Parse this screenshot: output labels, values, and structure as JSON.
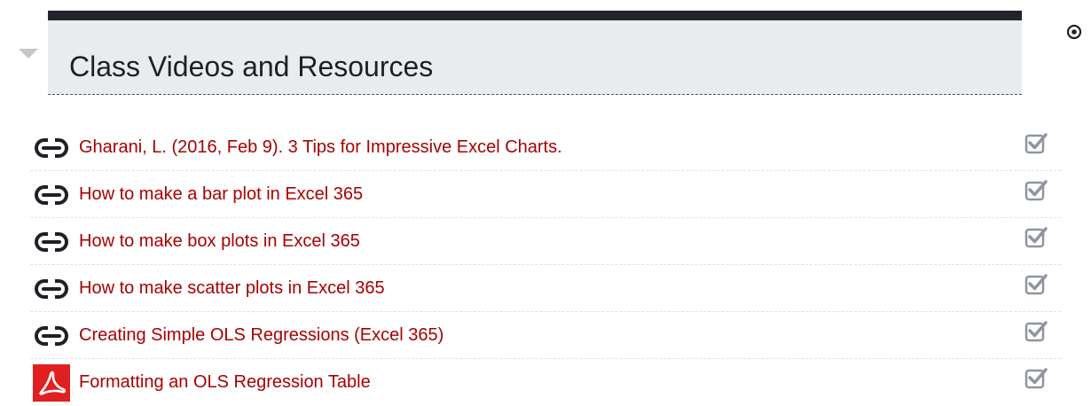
{
  "section": {
    "title": "Class Videos and Resources"
  },
  "activities": [
    {
      "type": "url",
      "icon": "link-icon",
      "label": "Gharani, L. (2016, Feb 9). 3 Tips for Impressive Excel Charts."
    },
    {
      "type": "url",
      "icon": "link-icon",
      "label": "How to make a bar plot in Excel 365"
    },
    {
      "type": "url",
      "icon": "link-icon",
      "label": "How to make box plots in Excel 365"
    },
    {
      "type": "url",
      "icon": "link-icon",
      "label": "How to make scatter plots in Excel 365"
    },
    {
      "type": "url",
      "icon": "link-icon",
      "label": "Creating Simple OLS Regressions (Excel 365)"
    },
    {
      "type": "pdf",
      "icon": "pdf-icon",
      "label": "Formatting an OLS Regression Table"
    }
  ],
  "colors": {
    "link": "#a80000",
    "header_bg": "#e9ecef",
    "header_bar": "#212529",
    "check": "#8f959e",
    "pdf_red": "#e02020"
  }
}
